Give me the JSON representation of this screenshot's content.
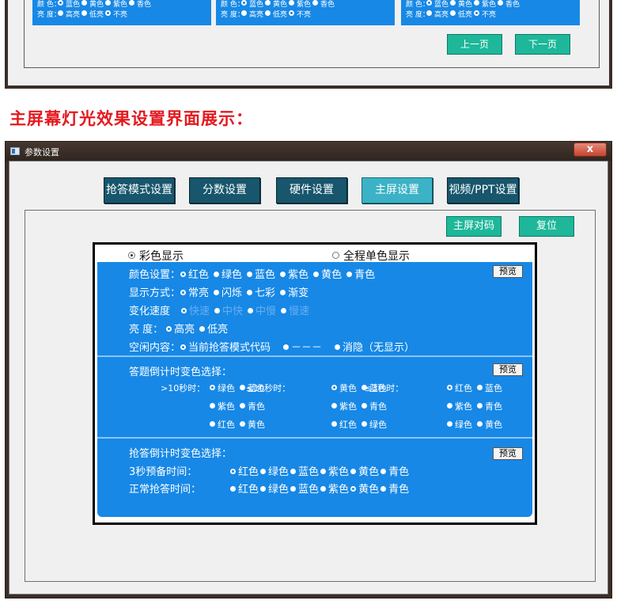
{
  "top_window": {
    "panels": [
      {
        "row1_label": "颜 色：",
        "row1_options": [
          "蓝色",
          "黄色",
          "紫色",
          "香色"
        ],
        "row1_selected": 0,
        "row2_label": "亮 度：",
        "row2_options": [
          "高亮",
          "低亮",
          "不亮"
        ],
        "row2_selected": 2
      },
      {
        "row1_label": "颜 色：",
        "row1_options": [
          "蓝色",
          "黄色",
          "紫色",
          "香色"
        ],
        "row1_selected": 0,
        "row2_label": "亮 度：",
        "row2_options": [
          "高亮",
          "低亮",
          "不亮"
        ],
        "row2_selected": 2
      },
      {
        "row1_label": "颜 色：",
        "row1_options": [
          "蓝色",
          "黄色",
          "紫色",
          "香色"
        ],
        "row1_selected": 0,
        "row2_label": "亮 度：",
        "row2_options": [
          "高亮",
          "低亮",
          "不亮"
        ],
        "row2_selected": 2
      }
    ],
    "prev_button": "上一页",
    "next_button": "下一页"
  },
  "caption": "主屏幕灯光效果设置界面展示：",
  "window": {
    "title": "参数设置",
    "close_symbol": "x",
    "tabs": [
      {
        "label": "抢答模式设置",
        "active": false
      },
      {
        "label": "分数设置",
        "active": false
      },
      {
        "label": "硬件设置",
        "active": false
      },
      {
        "label": "主屏设置",
        "active": true
      },
      {
        "label": "视频/PPT设置",
        "active": false
      }
    ],
    "pair_button": "主屏对码",
    "reset_button": "复位"
  },
  "display_mode": {
    "options": [
      "彩色显示",
      "全程单色显示"
    ],
    "selected": 0
  },
  "section1": {
    "preview_button": "预览",
    "color": {
      "label": "颜色设置：",
      "options": [
        "红色",
        "绿色",
        "蓝色",
        "紫色",
        "黄色",
        "青色"
      ],
      "selected": 0
    },
    "mode": {
      "label": "显示方式：",
      "options": [
        "常亮",
        "闪烁",
        "七彩",
        "渐变"
      ],
      "selected": 0
    },
    "speed": {
      "label": "变化速度",
      "options": [
        "快速",
        "中快",
        "中慢",
        "慢速"
      ],
      "selected": 0
    },
    "brightness": {
      "label": "亮    度：",
      "options": [
        "高亮",
        "低亮"
      ],
      "selected": 0
    },
    "idle": {
      "label": "空闲内容：",
      "options": [
        "当前抢答模式代码",
        "－－－",
        "消隐（无显示）"
      ],
      "selected": 0
    }
  },
  "section2": {
    "title": "答题倒计时变色选择：",
    "preview_button": "预览",
    "groups": [
      {
        "label": ">10秒时：",
        "rows": [
          [
            "绿色",
            "蓝色"
          ],
          [
            "紫色",
            "青色"
          ],
          [
            "红色",
            "黄色"
          ]
        ],
        "selected": "绿色"
      },
      {
        "label": "≤10秒时：",
        "rows": [
          [
            "黄色",
            "蓝色"
          ],
          [
            "紫色",
            "青色"
          ],
          [
            "红色",
            "绿色"
          ]
        ],
        "selected": "黄色"
      },
      {
        "label": "≤3秒时：",
        "rows": [
          [
            "红色",
            "蓝色"
          ],
          [
            "紫色",
            "青色"
          ],
          [
            "绿色",
            "黄色"
          ]
        ],
        "selected": "红色"
      }
    ]
  },
  "section3": {
    "title": "抢答倒计时变色选择：",
    "preview_button": "预览",
    "rows": [
      {
        "label": "3秒预备时间：",
        "options": [
          "红色",
          "绿色",
          "蓝色",
          "紫色",
          "黄色",
          "青色"
        ],
        "selected": 0
      },
      {
        "label": "正常抢答时间：",
        "options": [
          "红色",
          "绿色",
          "蓝色",
          "紫色",
          "黄色",
          "青色"
        ],
        "selected": 4
      }
    ]
  }
}
